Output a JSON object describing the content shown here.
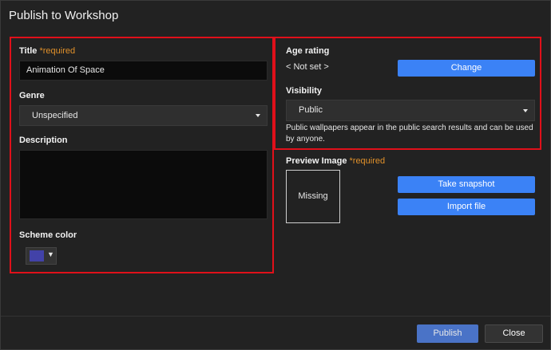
{
  "window": {
    "title": "Publish to Workshop"
  },
  "title_field": {
    "label": "Title",
    "required": "*required",
    "value": "Animation Of Space"
  },
  "genre": {
    "label": "Genre",
    "value": "Unspecified"
  },
  "description": {
    "label": "Description",
    "value": ""
  },
  "scheme_color": {
    "label": "Scheme color",
    "swatch": "#4242a8"
  },
  "age_rating": {
    "label": "Age rating",
    "value": "< Not set >",
    "button": "Change"
  },
  "visibility": {
    "label": "Visibility",
    "value": "Public",
    "help": "Public wallpapers appear in the public search results and can be used by anyone."
  },
  "preview_image": {
    "label": "Preview Image",
    "required": "*required",
    "placeholder": "Missing",
    "take_snapshot": "Take snapshot",
    "import_file": "Import file"
  },
  "footer": {
    "publish": "Publish",
    "close": "Close"
  },
  "colors": {
    "accent": "#3b82f6",
    "highlight": "#e0101a",
    "required": "#e0902a"
  }
}
